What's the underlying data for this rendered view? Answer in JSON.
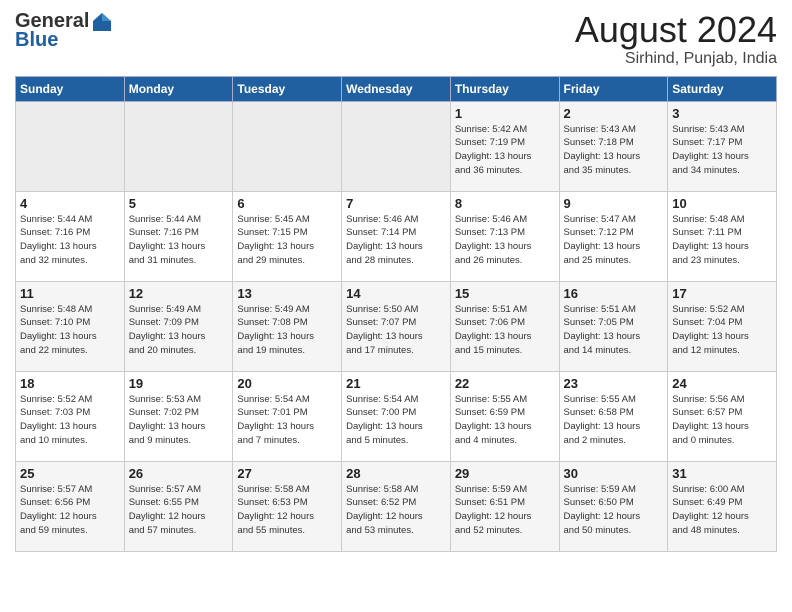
{
  "header": {
    "logo_general": "General",
    "logo_blue": "Blue",
    "title": "August 2024",
    "subtitle": "Sirhind, Punjab, India"
  },
  "weekdays": [
    "Sunday",
    "Monday",
    "Tuesday",
    "Wednesday",
    "Thursday",
    "Friday",
    "Saturday"
  ],
  "weeks": [
    [
      {
        "day": "",
        "info": ""
      },
      {
        "day": "",
        "info": ""
      },
      {
        "day": "",
        "info": ""
      },
      {
        "day": "",
        "info": ""
      },
      {
        "day": "1",
        "info": "Sunrise: 5:42 AM\nSunset: 7:19 PM\nDaylight: 13 hours\nand 36 minutes."
      },
      {
        "day": "2",
        "info": "Sunrise: 5:43 AM\nSunset: 7:18 PM\nDaylight: 13 hours\nand 35 minutes."
      },
      {
        "day": "3",
        "info": "Sunrise: 5:43 AM\nSunset: 7:17 PM\nDaylight: 13 hours\nand 34 minutes."
      }
    ],
    [
      {
        "day": "4",
        "info": "Sunrise: 5:44 AM\nSunset: 7:16 PM\nDaylight: 13 hours\nand 32 minutes."
      },
      {
        "day": "5",
        "info": "Sunrise: 5:44 AM\nSunset: 7:16 PM\nDaylight: 13 hours\nand 31 minutes."
      },
      {
        "day": "6",
        "info": "Sunrise: 5:45 AM\nSunset: 7:15 PM\nDaylight: 13 hours\nand 29 minutes."
      },
      {
        "day": "7",
        "info": "Sunrise: 5:46 AM\nSunset: 7:14 PM\nDaylight: 13 hours\nand 28 minutes."
      },
      {
        "day": "8",
        "info": "Sunrise: 5:46 AM\nSunset: 7:13 PM\nDaylight: 13 hours\nand 26 minutes."
      },
      {
        "day": "9",
        "info": "Sunrise: 5:47 AM\nSunset: 7:12 PM\nDaylight: 13 hours\nand 25 minutes."
      },
      {
        "day": "10",
        "info": "Sunrise: 5:48 AM\nSunset: 7:11 PM\nDaylight: 13 hours\nand 23 minutes."
      }
    ],
    [
      {
        "day": "11",
        "info": "Sunrise: 5:48 AM\nSunset: 7:10 PM\nDaylight: 13 hours\nand 22 minutes."
      },
      {
        "day": "12",
        "info": "Sunrise: 5:49 AM\nSunset: 7:09 PM\nDaylight: 13 hours\nand 20 minutes."
      },
      {
        "day": "13",
        "info": "Sunrise: 5:49 AM\nSunset: 7:08 PM\nDaylight: 13 hours\nand 19 minutes."
      },
      {
        "day": "14",
        "info": "Sunrise: 5:50 AM\nSunset: 7:07 PM\nDaylight: 13 hours\nand 17 minutes."
      },
      {
        "day": "15",
        "info": "Sunrise: 5:51 AM\nSunset: 7:06 PM\nDaylight: 13 hours\nand 15 minutes."
      },
      {
        "day": "16",
        "info": "Sunrise: 5:51 AM\nSunset: 7:05 PM\nDaylight: 13 hours\nand 14 minutes."
      },
      {
        "day": "17",
        "info": "Sunrise: 5:52 AM\nSunset: 7:04 PM\nDaylight: 13 hours\nand 12 minutes."
      }
    ],
    [
      {
        "day": "18",
        "info": "Sunrise: 5:52 AM\nSunset: 7:03 PM\nDaylight: 13 hours\nand 10 minutes."
      },
      {
        "day": "19",
        "info": "Sunrise: 5:53 AM\nSunset: 7:02 PM\nDaylight: 13 hours\nand 9 minutes."
      },
      {
        "day": "20",
        "info": "Sunrise: 5:54 AM\nSunset: 7:01 PM\nDaylight: 13 hours\nand 7 minutes."
      },
      {
        "day": "21",
        "info": "Sunrise: 5:54 AM\nSunset: 7:00 PM\nDaylight: 13 hours\nand 5 minutes."
      },
      {
        "day": "22",
        "info": "Sunrise: 5:55 AM\nSunset: 6:59 PM\nDaylight: 13 hours\nand 4 minutes."
      },
      {
        "day": "23",
        "info": "Sunrise: 5:55 AM\nSunset: 6:58 PM\nDaylight: 13 hours\nand 2 minutes."
      },
      {
        "day": "24",
        "info": "Sunrise: 5:56 AM\nSunset: 6:57 PM\nDaylight: 13 hours\nand 0 minutes."
      }
    ],
    [
      {
        "day": "25",
        "info": "Sunrise: 5:57 AM\nSunset: 6:56 PM\nDaylight: 12 hours\nand 59 minutes."
      },
      {
        "day": "26",
        "info": "Sunrise: 5:57 AM\nSunset: 6:55 PM\nDaylight: 12 hours\nand 57 minutes."
      },
      {
        "day": "27",
        "info": "Sunrise: 5:58 AM\nSunset: 6:53 PM\nDaylight: 12 hours\nand 55 minutes."
      },
      {
        "day": "28",
        "info": "Sunrise: 5:58 AM\nSunset: 6:52 PM\nDaylight: 12 hours\nand 53 minutes."
      },
      {
        "day": "29",
        "info": "Sunrise: 5:59 AM\nSunset: 6:51 PM\nDaylight: 12 hours\nand 52 minutes."
      },
      {
        "day": "30",
        "info": "Sunrise: 5:59 AM\nSunset: 6:50 PM\nDaylight: 12 hours\nand 50 minutes."
      },
      {
        "day": "31",
        "info": "Sunrise: 6:00 AM\nSunset: 6:49 PM\nDaylight: 12 hours\nand 48 minutes."
      }
    ]
  ]
}
